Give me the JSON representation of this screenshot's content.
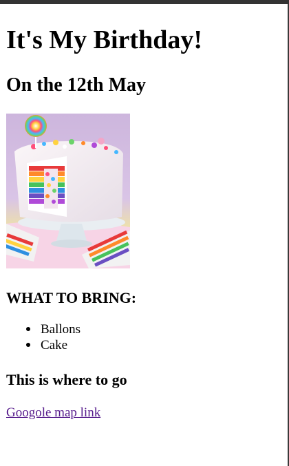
{
  "page": {
    "title": "It's My Birthday!",
    "subtitle": "On the 12th May"
  },
  "image": {
    "description_icon": "rainbow-layer-cake-image"
  },
  "bring_section": {
    "heading": "WHAT TO BRING:",
    "items": [
      "Ballons",
      "Cake"
    ]
  },
  "location_section": {
    "heading": "This is where to go",
    "link_text": "Googole map link"
  },
  "colors": {
    "link_visited": "#551a8b",
    "text": "#000000",
    "background": "#ffffff",
    "frame": "#333333"
  }
}
